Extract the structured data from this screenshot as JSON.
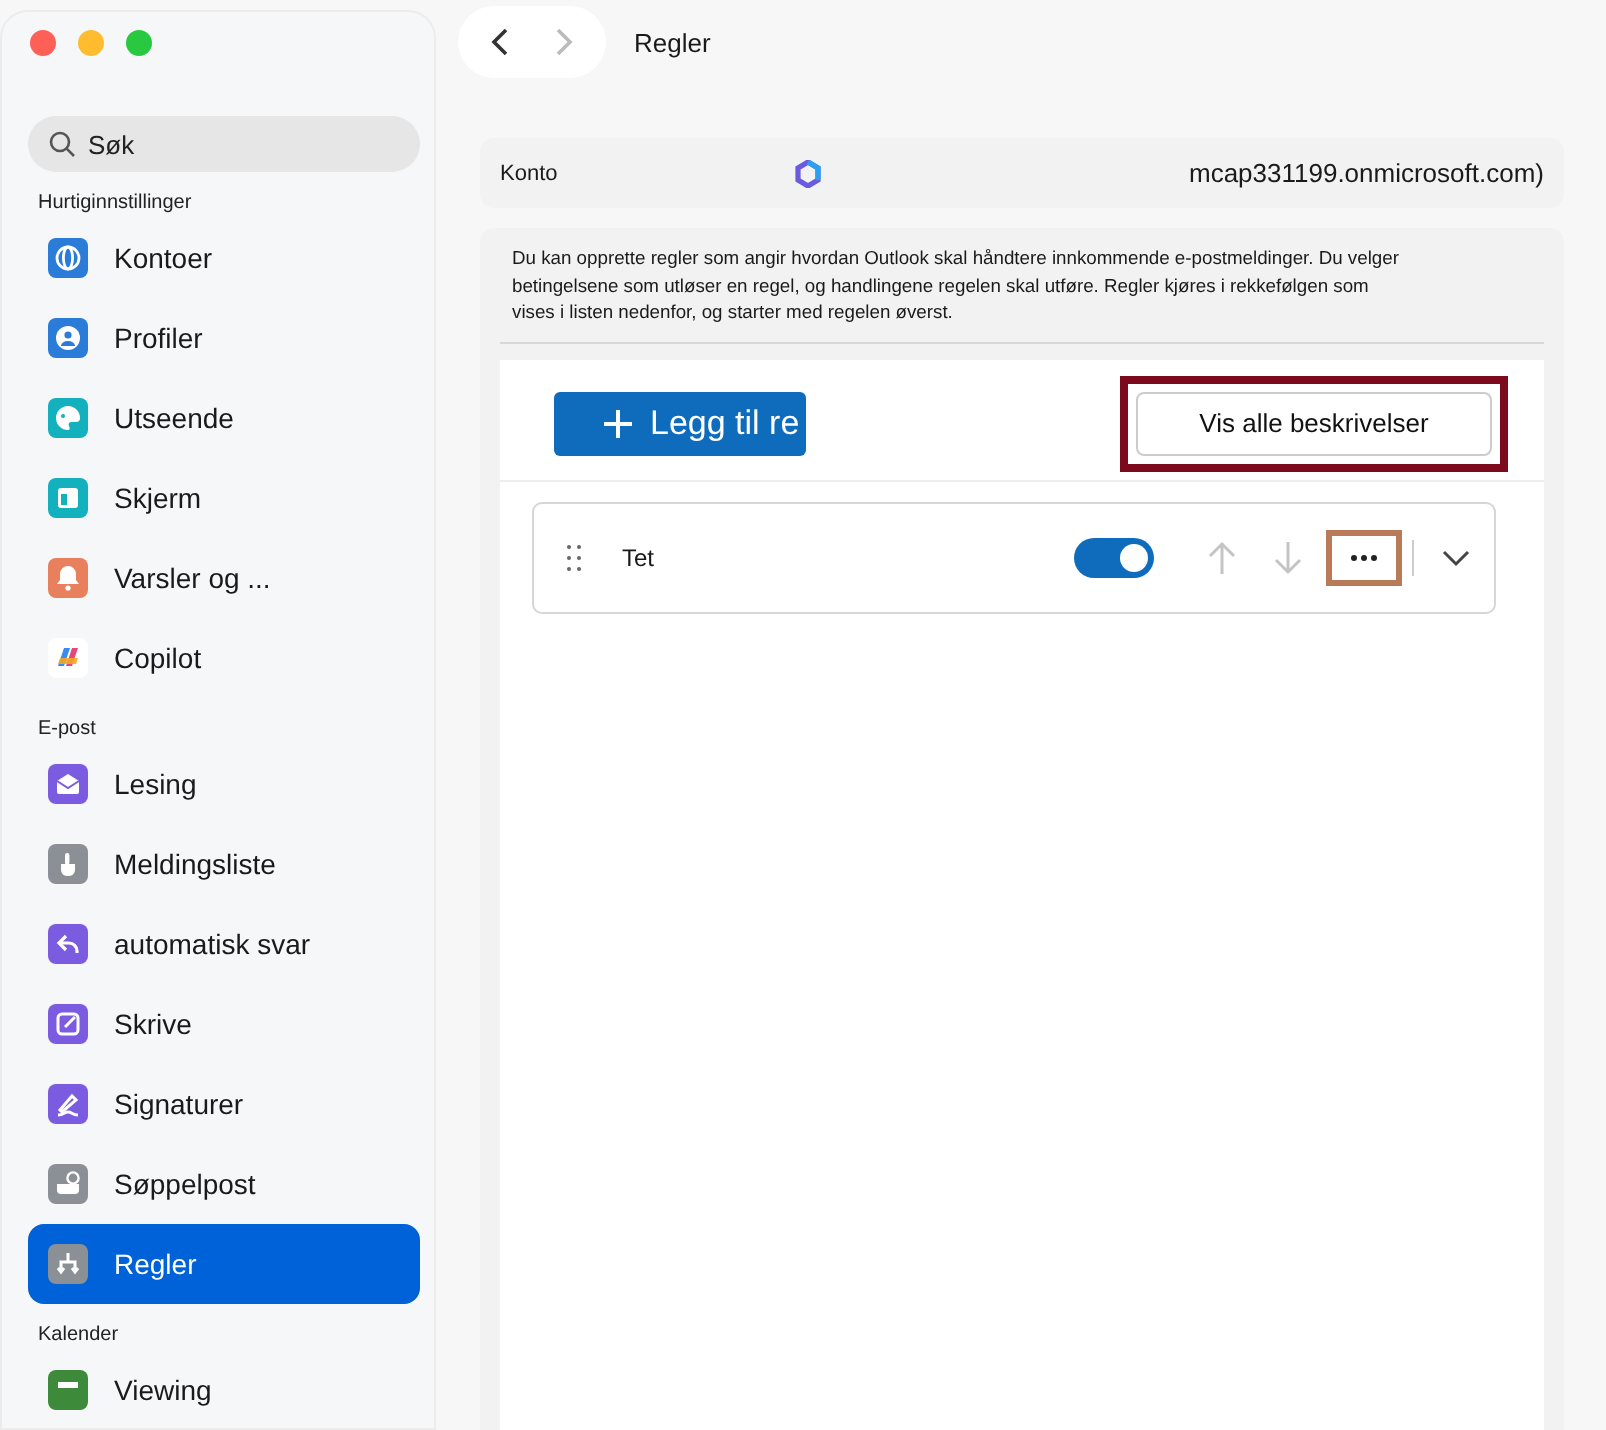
{
  "search": {
    "placeholder": "Søk"
  },
  "sidebar": {
    "sections": [
      {
        "title": "Hurtiginnstillinger",
        "items": [
          {
            "label": "Kontoer",
            "kind": "globe",
            "selected": false
          },
          {
            "label": "Profiler",
            "kind": "person",
            "selected": false
          },
          {
            "label": "Utseende",
            "kind": "palette",
            "selected": false
          },
          {
            "label": "Skjerm",
            "kind": "screen",
            "selected": false
          },
          {
            "label": "Varsler og ...",
            "kind": "bell",
            "selected": false
          },
          {
            "label": "Copilot",
            "kind": "copilot",
            "selected": false
          }
        ]
      },
      {
        "title": "E-post",
        "items": [
          {
            "label": "Lesing",
            "kind": "envelope",
            "selected": false
          },
          {
            "label": "Meldingsliste",
            "kind": "hand",
            "selected": false
          },
          {
            "label": "automatisk svar",
            "kind": "reply",
            "selected": false
          },
          {
            "label": "Skrive",
            "kind": "compose",
            "selected": false
          },
          {
            "label": "Signaturer",
            "kind": "pen",
            "selected": false
          },
          {
            "label": "Søppelpost",
            "kind": "junk",
            "selected": false
          },
          {
            "label": "Regler",
            "kind": "rules",
            "selected": true
          }
        ]
      },
      {
        "title": "Kalender",
        "items": [
          {
            "label": "Viewing",
            "kind": "calendar",
            "selected": false
          }
        ]
      }
    ]
  },
  "nav": {
    "title": "Regler",
    "forward_disabled": true
  },
  "account": {
    "label": "Konto",
    "value": "mcap331199.onmicrosoft.com)"
  },
  "description": "Du kan opprette regler som angir hvordan Outlook skal håndtere innkommende e-postmeldinger. Du velger betingelsene som utløser en regel, og handlingene regelen skal utføre. Regler kjøres i rekkefølgen som vises i listen nedenfor, og starter med regelen øverst.",
  "add_button": {
    "label": "Legg til re"
  },
  "show_all_button": {
    "label": "Vis alle beskrivelser",
    "highlighted": true
  },
  "rules": [
    {
      "name": "Tet",
      "on": true,
      "more_highlighted": true
    }
  ]
}
